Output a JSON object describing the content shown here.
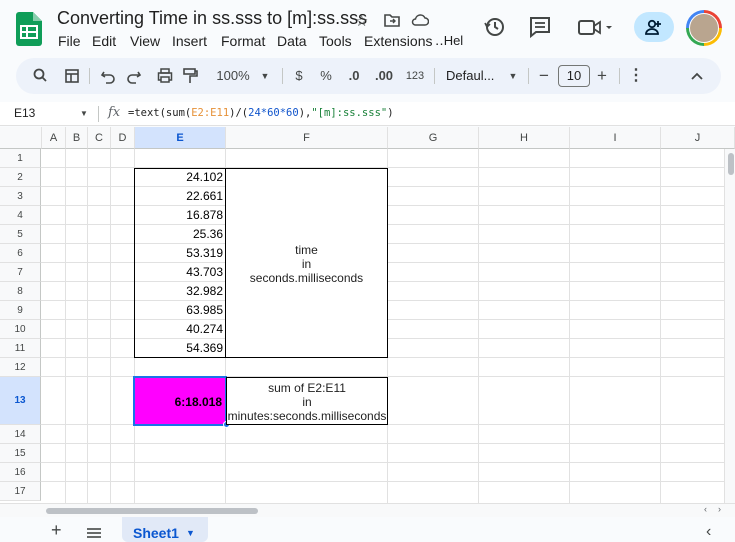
{
  "app": {
    "title": "Converting Time in ss.sss to [m]:ss.sss",
    "menu": [
      "File",
      "Edit",
      "View",
      "Insert",
      "Format",
      "Data",
      "Tools",
      "Extensions",
      "Hel"
    ]
  },
  "toolbar": {
    "zoom": "100%",
    "currency": "$",
    "percent": "%",
    "dec_decrease": ".0",
    "dec_increase": ".00",
    "number_format": "123",
    "font": "Defaul...",
    "font_size": "10",
    "minus": "−",
    "plus": "+"
  },
  "formula_bar": {
    "cell_ref": "E13",
    "fx": "fx",
    "formula_parts": {
      "p1": "=text(sum(",
      "p2": "E2:E11",
      "p3": ")/(",
      "p4": "24*60*60",
      "p5": "),",
      "p6": "\"[m]:ss.sss\"",
      "p7": ")"
    }
  },
  "grid": {
    "columns": [
      "A",
      "B",
      "C",
      "D",
      "E",
      "F",
      "G",
      "H",
      "I",
      "J"
    ],
    "selected_column": "E",
    "rows": [
      "1",
      "2",
      "3",
      "4",
      "5",
      "6",
      "7",
      "8",
      "9",
      "10",
      "11",
      "12",
      "13",
      "14",
      "15",
      "16",
      "17"
    ],
    "selected_row": "13",
    "e_values": [
      "24.102",
      "22.661",
      "16.878",
      "25.36",
      "53.319",
      "43.703",
      "32.982",
      "63.985",
      "40.274",
      "54.369"
    ],
    "f_label_lines": [
      "time",
      "in",
      "seconds.milliseconds"
    ],
    "e13_value": "6:18.018",
    "f13_lines": [
      "sum of E2:E11",
      "in",
      "minutes:seconds.milliseconds"
    ]
  },
  "sheets": {
    "active": "Sheet1"
  },
  "colors": {
    "e13_fill": "#ff00ff",
    "selection": "#d3e3fd",
    "accent": "#0b57d0",
    "share_bg": "#c2e7ff"
  }
}
